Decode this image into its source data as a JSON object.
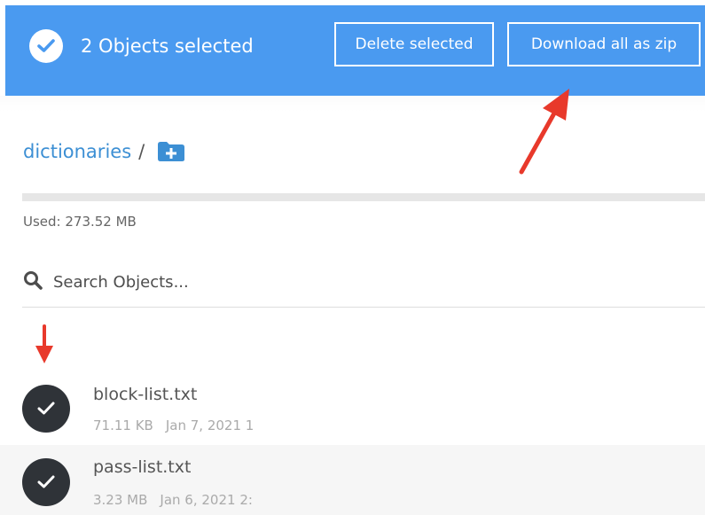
{
  "selection_bar": {
    "count_text": "2 Objects selected",
    "delete_label": "Delete selected",
    "download_label": "Download all as zip",
    "check_icon": "check-circle-icon"
  },
  "breadcrumb": {
    "folder": "dictionaries",
    "separator": "/",
    "new_folder_icon": "folder-plus-icon"
  },
  "usage": {
    "text": "Used: 273.52 MB"
  },
  "search": {
    "placeholder": "Search Objects...",
    "icon": "search-icon"
  },
  "files": [
    {
      "name": "block-list.txt",
      "size": "71.11 KB",
      "modified": "Jan 7, 2021 1",
      "selected": true
    },
    {
      "name": "pass-list.txt",
      "size": "3.23 MB",
      "modified": "Jan 6, 2021 2:",
      "selected": true
    }
  ],
  "colors": {
    "accent": "#4a9af0",
    "link": "#3c8fd4",
    "selected_check": "#2f3338",
    "annotation_arrow": "#e8392b"
  }
}
